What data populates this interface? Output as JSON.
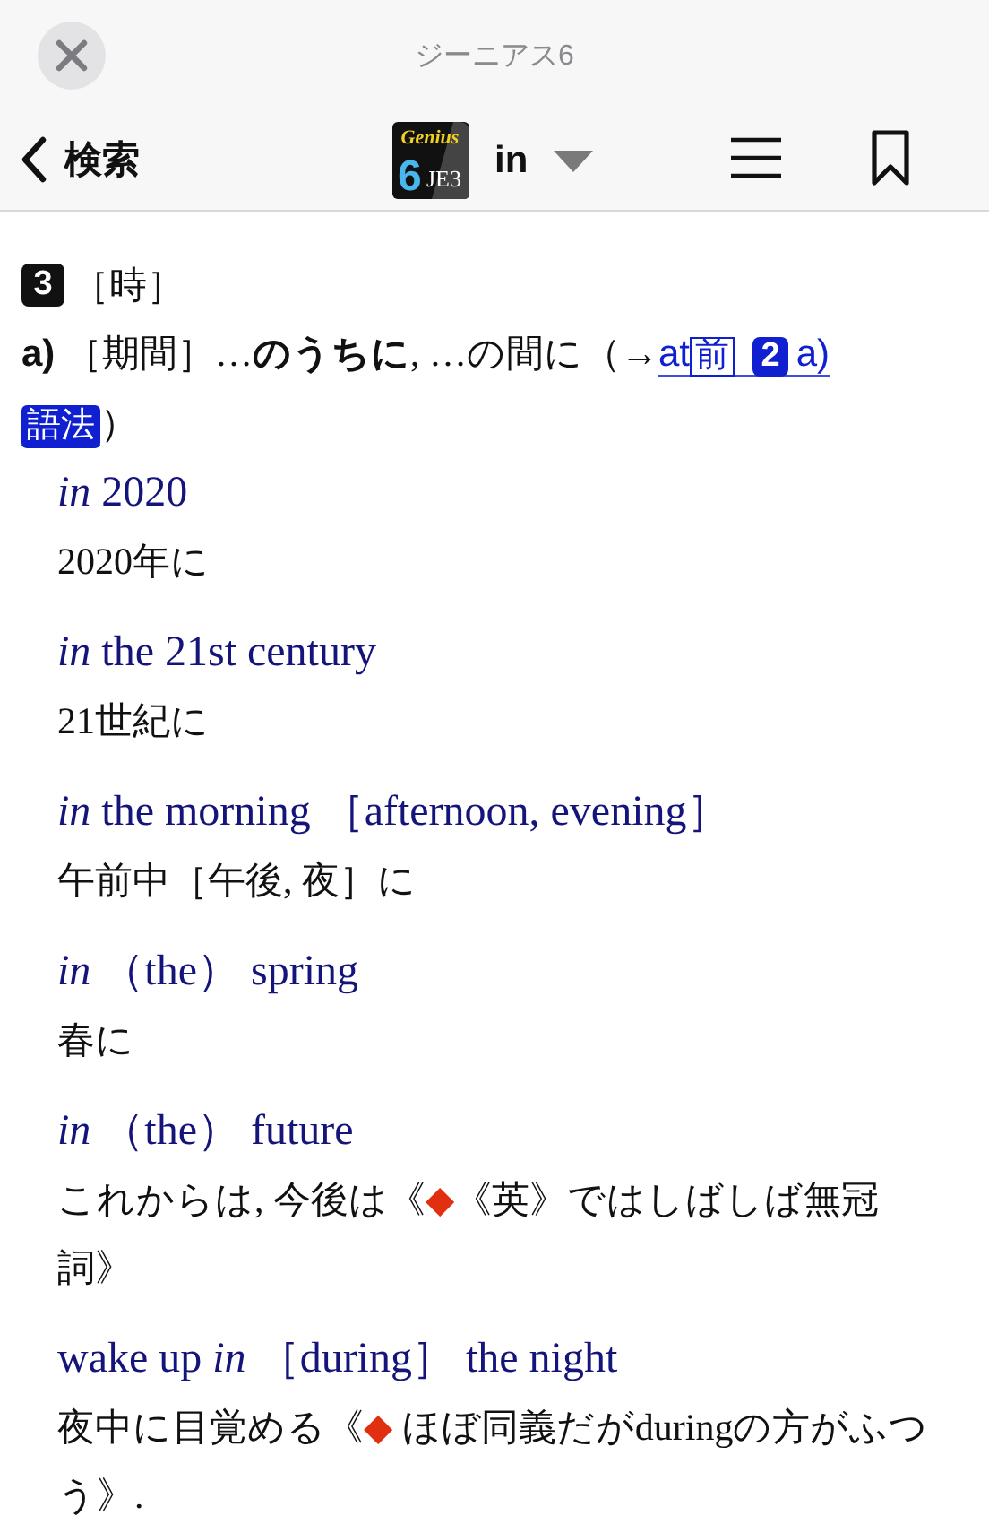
{
  "header": {
    "title": "ジーニアス6",
    "back_label": "検索",
    "logo": {
      "brand": "Genius",
      "edition": "6",
      "code": "JE3"
    },
    "query": "in"
  },
  "entry": {
    "sense_number": "3",
    "sense_label": "［時］",
    "definition": {
      "marker": "a)",
      "text": "［期間］…**のうちに**, …の間に（→",
      "cross_ref": {
        "word": "at",
        "part_of_speech": "前",
        "sense": "2",
        "sub": "a)"
      },
      "usage_badge": "語法",
      "close": "）"
    },
    "examples": [
      {
        "phrase": "*in* 2020",
        "translation": "2020年に"
      },
      {
        "phrase": "*in* the 21st century",
        "translation": "21世紀に"
      },
      {
        "phrase": "*in* the morning ［afternoon, evening］",
        "translation": "午前中［午後, 夜］に"
      },
      {
        "phrase": "*in* （the） spring",
        "translation": "春に"
      },
      {
        "phrase": "*in* （the） future",
        "translation": "これからは, 今後は",
        "note": {
          "open": "《",
          "mark": "◆",
          "text": "《英》ではしばしば無冠詞",
          "close": "》"
        }
      },
      {
        "phrase": "wake up *in* ［during］ the night",
        "translation": "夜中に目覚める",
        "note": {
          "open": "《",
          "mark": "◆",
          "text": " ほぼ同義だがduringの方がふつう",
          "close": "》."
        }
      }
    ]
  }
}
